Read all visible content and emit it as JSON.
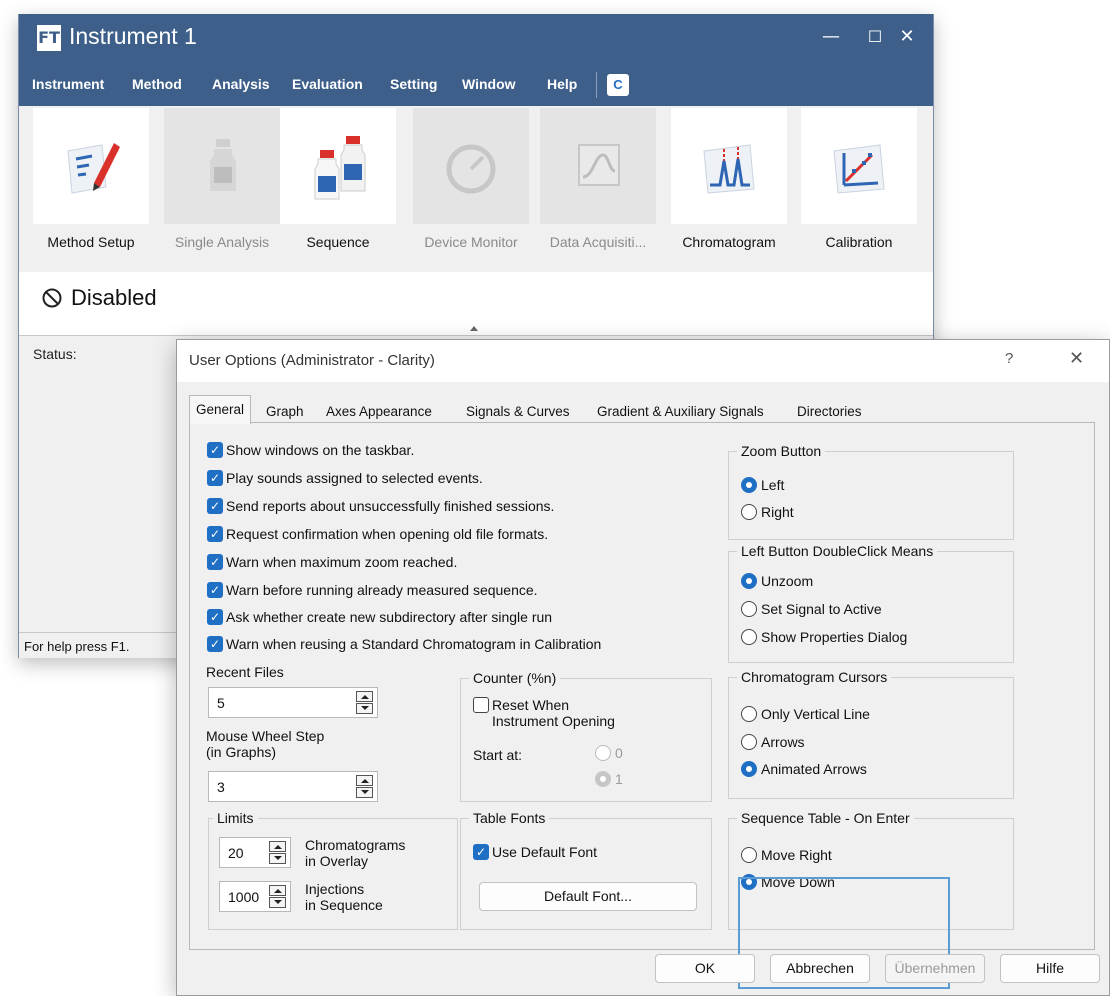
{
  "instrument_window": {
    "title": "Instrument 1",
    "logo_glyph": "FT",
    "window_controls": {
      "minimize": "—",
      "maximize": "☐",
      "close": "✕"
    },
    "menu": [
      "Instrument",
      "Method",
      "Analysis",
      "Evaluation",
      "Setting",
      "Window",
      "Help"
    ],
    "menu_icon_glyph": "C",
    "toolbar": [
      {
        "label": "Method Setup",
        "icon": "method-setup-icon",
        "enabled": true
      },
      {
        "label": "Single Analysis",
        "icon": "single-analysis-icon",
        "enabled": false
      },
      {
        "label": "Sequence",
        "icon": "sequence-icon",
        "enabled": true
      },
      {
        "label": "Device Monitor",
        "icon": "device-monitor-icon",
        "enabled": false
      },
      {
        "label": "Data Acquisiti...",
        "icon": "data-acquisition-icon",
        "enabled": false
      },
      {
        "label": "Chromatogram",
        "icon": "chromatogram-icon",
        "enabled": true
      },
      {
        "label": "Calibration",
        "icon": "calibration-icon",
        "enabled": true
      }
    ],
    "state": "Disabled",
    "status_label": "Status:",
    "help_text": "For help press F1.",
    "colors": {
      "title_bar": "#3d5f8a",
      "accent": "#1f6fc4"
    }
  },
  "dialog": {
    "title": "User Options (Administrator - Clarity)",
    "help_button": "?",
    "close_button": "✕",
    "tabs": [
      "General",
      "Graph",
      "Axes Appearance",
      "Signals & Curves",
      "Gradient & Auxiliary Signals",
      "Directories"
    ],
    "active_tab": "General",
    "checkboxes": [
      {
        "label": "Show windows on the taskbar.",
        "checked": true
      },
      {
        "label": "Play sounds assigned to selected events.",
        "checked": true
      },
      {
        "label": "Send reports about unsuccessfully finished sessions.",
        "checked": true
      },
      {
        "label": "Request confirmation when opening old file formats.",
        "checked": true
      },
      {
        "label": "Warn when maximum zoom reached.",
        "checked": true
      },
      {
        "label": "Warn before running already measured sequence.",
        "checked": true
      },
      {
        "label": "Ask whether create new subdirectory after single run",
        "checked": true
      },
      {
        "label": "Warn when reusing a Standard Chromatogram in Calibration",
        "checked": true
      }
    ],
    "recent_files": {
      "label": "Recent Files",
      "value": "5"
    },
    "mouse_wheel": {
      "label_line1": "Mouse Wheel Step",
      "label_line2": "(in Graphs)",
      "value": "3"
    },
    "limits": {
      "title": "Limits",
      "chromatograms": {
        "value": "20",
        "label_line1": "Chromatograms",
        "label_line2": "in Overlay"
      },
      "injections": {
        "value": "1000",
        "label_line1": "Injections",
        "label_line2": "in Sequence"
      }
    },
    "counter": {
      "title": "Counter (%n)",
      "reset_line1": "Reset When",
      "reset_line2": "Instrument Opening",
      "reset_checked": false,
      "start_at_label": "Start at:",
      "options": [
        {
          "label": "0",
          "selected": false
        },
        {
          "label": "1",
          "selected": true
        }
      ]
    },
    "table_fonts": {
      "title": "Table Fonts",
      "use_default_label": "Use Default Font",
      "use_default_checked": true,
      "default_font_button": "Default Font..."
    },
    "zoom_button": {
      "title": "Zoom Button",
      "options": [
        {
          "label": "Left",
          "selected": true
        },
        {
          "label": "Right",
          "selected": false
        }
      ]
    },
    "left_double_click": {
      "title": "Left Button DoubleClick Means",
      "options": [
        {
          "label": "Unzoom",
          "selected": true
        },
        {
          "label": "Set Signal to Active",
          "selected": false
        },
        {
          "label": "Show Properties Dialog",
          "selected": false
        }
      ]
    },
    "chromatogram_cursors": {
      "title": "Chromatogram Cursors",
      "options": [
        {
          "label": "Only Vertical Line",
          "selected": false
        },
        {
          "label": "Arrows",
          "selected": false
        },
        {
          "label": "Animated Arrows",
          "selected": true
        }
      ]
    },
    "sequence_table": {
      "title": "Sequence Table - On Enter",
      "options": [
        {
          "label": "Move Right",
          "selected": false
        },
        {
          "label": "Move Down",
          "selected": true
        }
      ]
    },
    "buttons": {
      "ok": "OK",
      "cancel": "Abbrechen",
      "apply": "Übernehmen",
      "help": "Hilfe"
    }
  }
}
